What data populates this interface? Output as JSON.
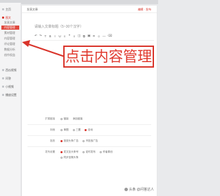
{
  "sidebar": {
    "items": [
      {
        "label": "主页"
      },
      {
        "label": "图文"
      },
      {
        "label": "西瓜视频"
      },
      {
        "label": "问答"
      },
      {
        "label": "小视频"
      },
      {
        "label": "播放设置"
      }
    ],
    "subitems": [
      {
        "label": "发表文章"
      },
      {
        "label": "内容管理"
      },
      {
        "label": "素材管理"
      },
      {
        "label": "内容管理"
      },
      {
        "label": "评论管理"
      },
      {
        "label": "数据分析"
      },
      {
        "label": "创作权益"
      }
    ]
  },
  "main": {
    "tab_label": "发表文章",
    "tab_link": "编辑 · 发布",
    "title_placeholder": "请输入文章标题（5~30个汉字）",
    "toolbar": [
      "↶",
      "↷",
      "T",
      "B",
      "I",
      "U",
      "≡",
      "❝",
      "≡",
      "◫",
      "⧉",
      "▣",
      "⌗",
      "☺",
      "—",
      "⌫"
    ]
  },
  "settings": {
    "rows": [
      {
        "label": "扩展链接",
        "options": [
          {
            "text": "链接",
            "on": false
          },
          {
            "text": "添加链接",
            "on": false
          }
        ]
      },
      {
        "label": "封面",
        "options": [
          {
            "text": "单图",
            "on": false
          },
          {
            "text": "三图",
            "on": false
          },
          {
            "text": "自动",
            "on": true
          }
        ]
      },
      {
        "label": "投放",
        "options": [
          {
            "text": "投放头条广告",
            "on": true
          },
          {
            "text": "不投放广告",
            "on": false
          }
        ]
      },
      {
        "label": "发布设置",
        "options": [
          {
            "text": "发文至头条号",
            "on": true
          },
          {
            "text": "定时发布",
            "on": false
          },
          {
            "text": "作者原创",
            "on": false
          },
          {
            "text": "同步至微头条",
            "on": false
          }
        ]
      }
    ]
  },
  "annotation": {
    "text": "点击内容管理",
    "color": "#d9342b"
  },
  "watermark": {
    "text": "头条 @问答达人"
  }
}
